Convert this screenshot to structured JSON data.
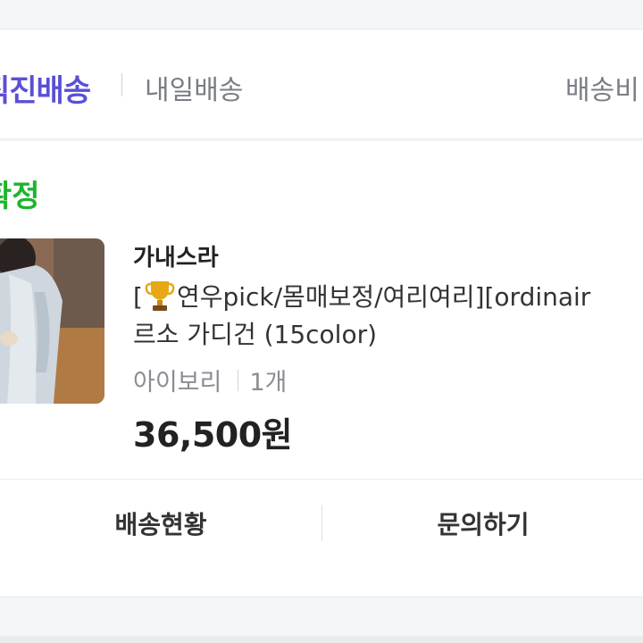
{
  "delivery": {
    "title": "직진배송",
    "tomorrow_label": "내일배송",
    "fee_label": "배송비"
  },
  "order": {
    "status": "확정",
    "seller": "가내스라",
    "product_name_prefix": "[",
    "trophy_icon": "trophy-icon",
    "product_name_rest": "연우pick/몸매보정/여리여리][ordinair",
    "product_name_line2": "르소 가디건 (15color)",
    "option_color": "아이보리",
    "option_qty": "1개",
    "price": "36,500원"
  },
  "actions": {
    "tracking_label": "배송현황",
    "inquiry_label": "문의하기"
  },
  "colors": {
    "accent_purple": "#5a4fd6",
    "status_green": "#1db42d"
  }
}
